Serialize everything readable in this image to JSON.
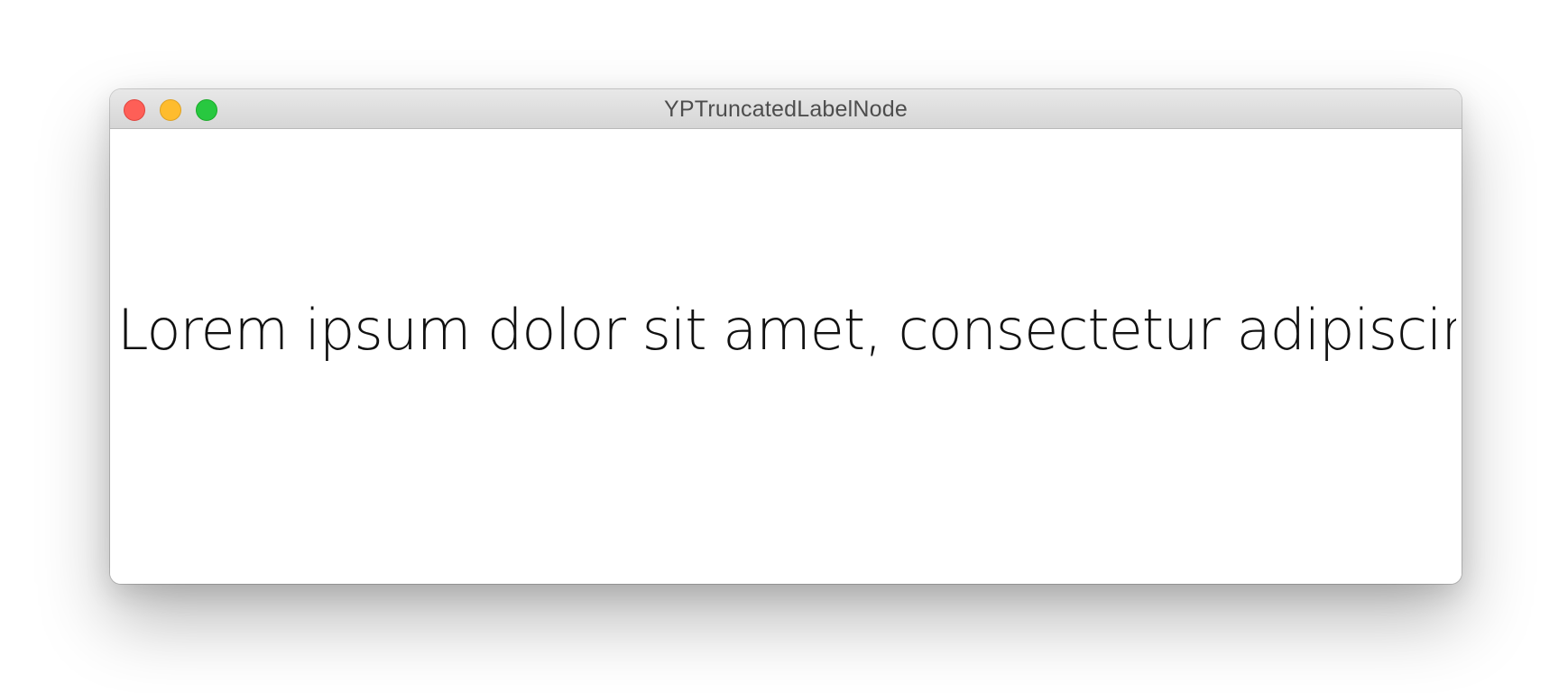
{
  "window": {
    "title": "YPTruncatedLabelNode"
  },
  "content": {
    "label_text": "Lorem ipsum dolor sit amet, consectetur adipiscing elit, sed …"
  },
  "colors": {
    "close": "#fe5f57",
    "minimize": "#febc2e",
    "zoom": "#28c840",
    "title_text": "#4d4d4d",
    "label_text": "#111111"
  },
  "icons": {
    "close": "close-button",
    "minimize": "minimize-button",
    "zoom": "zoom-button"
  }
}
